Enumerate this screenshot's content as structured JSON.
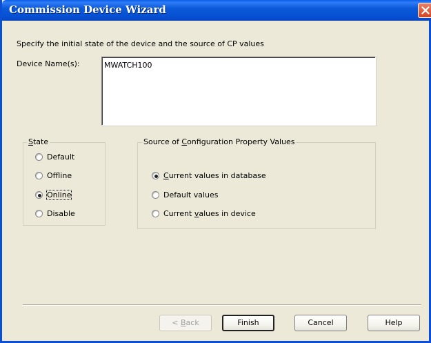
{
  "window": {
    "title": "Commission Device Wizard",
    "close_glyph": "✕",
    "colors": {
      "titlebar": "#0a5ee8",
      "body": "#ece9d8",
      "close": "#d7431f"
    }
  },
  "instruction": "Specify the initial state of the device and the source of CP values",
  "device": {
    "label": "Device Name(s):",
    "value": "MWATCH100"
  },
  "state_group": {
    "legend_first": "S",
    "legend_rest": "tate",
    "options": [
      {
        "label": "Default",
        "selected": false
      },
      {
        "label": "Offline",
        "selected": false
      },
      {
        "label": "Online",
        "selected": true
      },
      {
        "label": "Disable",
        "selected": false
      }
    ]
  },
  "source_group": {
    "legend_pre": "Source of ",
    "legend_mnemonic": "C",
    "legend_post": "onfiguration Property Values",
    "options": [
      {
        "pre": "",
        "mnemonic": "C",
        "post": "urrent values in database",
        "selected": true
      },
      {
        "pre": "Default values",
        "mnemonic": "",
        "post": "",
        "selected": false
      },
      {
        "pre": "Current ",
        "mnemonic": "v",
        "post": "alues in device",
        "selected": false
      }
    ]
  },
  "buttons": {
    "back_prefix": "< ",
    "back_mnemonic": "B",
    "back_rest": "ack",
    "finish": "Finish",
    "cancel": "Cancel",
    "help": "Help"
  }
}
